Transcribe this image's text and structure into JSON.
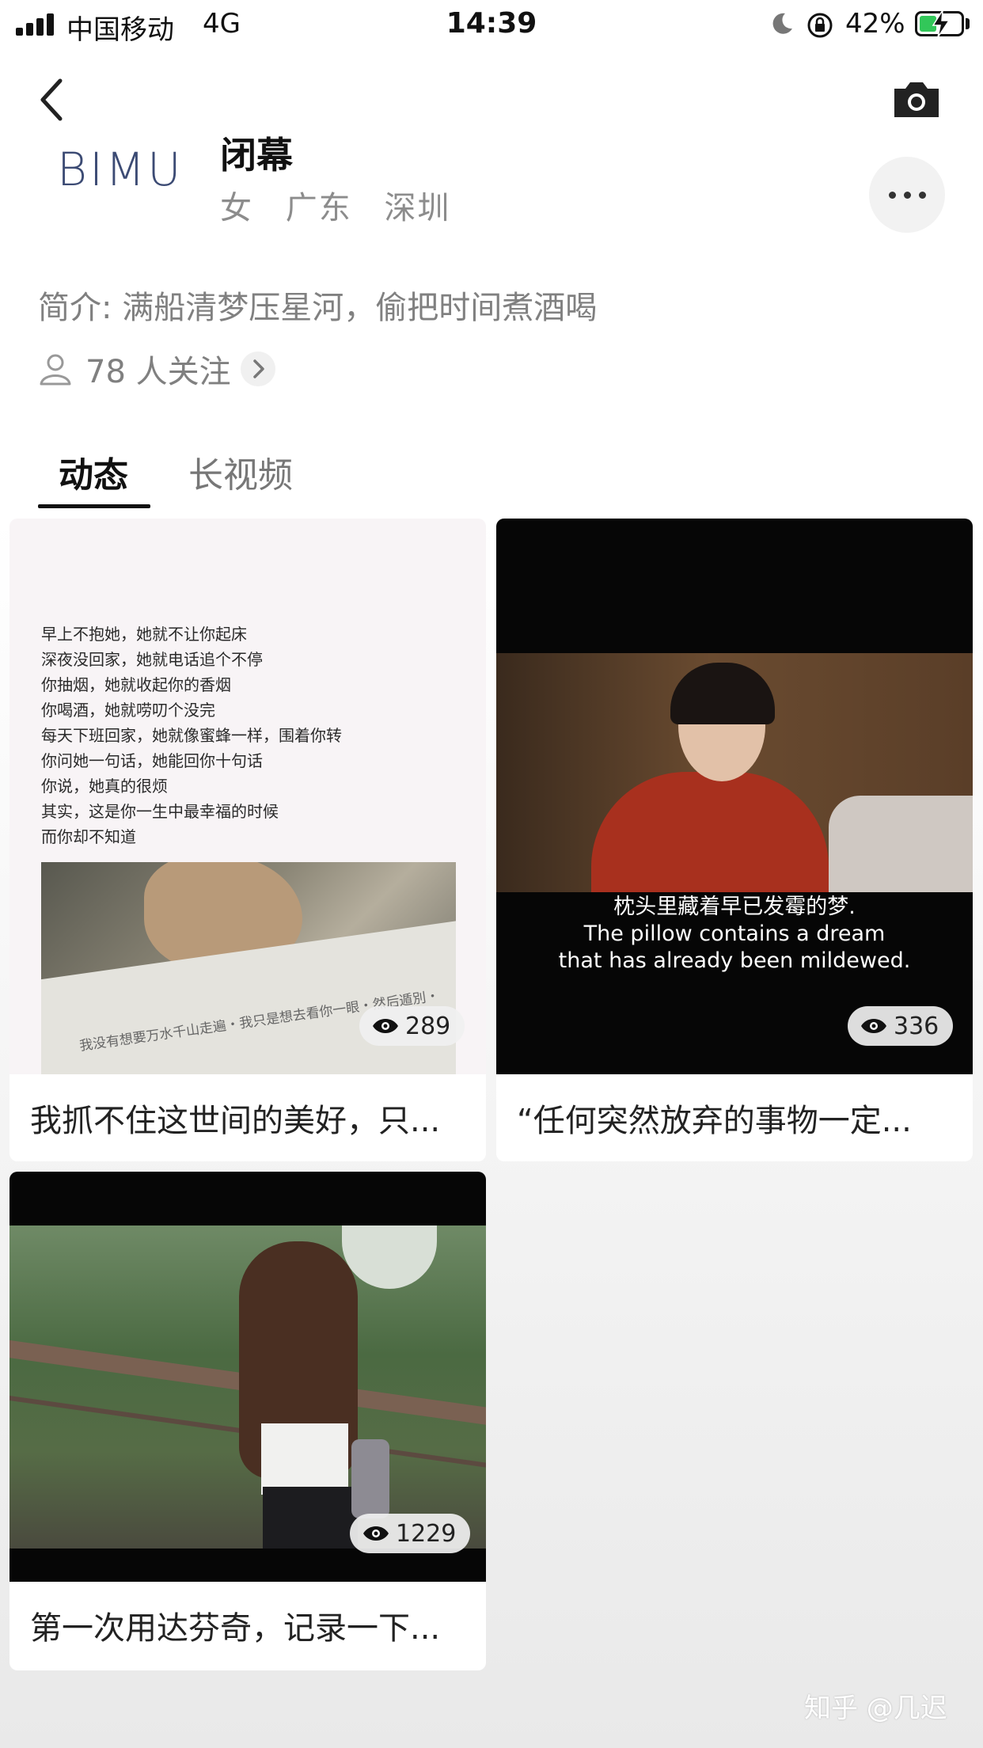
{
  "status_bar": {
    "carrier": "中国移动",
    "network": "4G",
    "time": "14:39",
    "battery_percent": "42%",
    "battery_level": 0.42
  },
  "profile": {
    "logo_text": "BIMU",
    "name": "闭幕",
    "gender": "女",
    "province": "广东",
    "city": "深圳",
    "intro": "简介: 满船清梦压星河，偷把时间煮酒喝",
    "followers": "78 人关注"
  },
  "tabs": [
    {
      "label": "动态",
      "active": true
    },
    {
      "label": "长视频",
      "active": false
    }
  ],
  "posts": [
    {
      "caption": "我抓不住这世间的美好，只...",
      "views": "289",
      "image_text": [
        "早上不抱她，她就不让你起床",
        "深夜没回家，她就电话追个不停",
        "你抽烟，她就收起你的香烟",
        "你喝酒，她就唠叨个没完",
        "每天下班回家，她就像蜜蜂一样，围着你转",
        "你问她一句话，她能回你十句话",
        "你说，她真的很烦",
        "其实，这是你一生中最幸福的时候",
        "而你却不知道"
      ],
      "book_text": "我没有想要万水千山走遍・我只是想去看你一眼・然后遁別・"
    },
    {
      "caption": "“任何突然放弃的事物一定...",
      "views": "336",
      "subtitles": [
        "枕头里藏着早已发霉的梦.",
        "The pillow contains a dream",
        "that has already been mildewed."
      ]
    },
    {
      "caption": "第一次用达芬奇，记录一下...",
      "views": "1229"
    }
  ],
  "watermark": "知乎 @几迟",
  "colors": {
    "battery_green": "#32c759",
    "logo_blue": "#3c4b74",
    "muted_text": "#808080"
  },
  "icons": [
    "signal-icon",
    "moon-icon",
    "rotation-lock-icon",
    "battery-icon",
    "back-icon",
    "camera-icon",
    "more-icon",
    "person-icon",
    "chevron-right-icon",
    "eye-icon"
  ]
}
